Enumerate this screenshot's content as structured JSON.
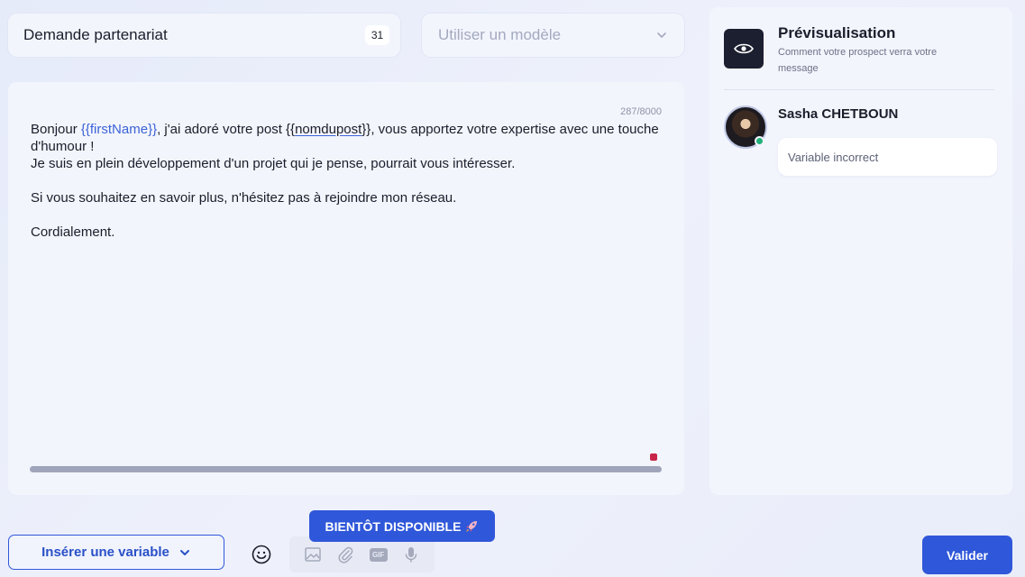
{
  "name_field": {
    "value": "Demande partenariat",
    "count": "31"
  },
  "template_select": {
    "placeholder": "Utiliser un modèle"
  },
  "editor": {
    "counter": "287/8000",
    "line1_a": "Bonjour ",
    "var_firstname": "{{firstName}}",
    "line1_b": ", j'ai adoré votre post ",
    "var_post_open": "{{",
    "var_post_name": "nomdupost",
    "var_post_close": "}}",
    "line1_c": ", vous apportez votre expertise avec une touche d'humour !",
    "line2": "Je suis en plein développement d'un projet qui je pense, pourrait vous intéresser.",
    "line3": "Si vous souhaitez en savoir plus, n'hésitez pas à rejoindre mon réseau.",
    "line4": "Cordialement."
  },
  "preview": {
    "title": "Prévisualisation",
    "subtitle": "Comment votre prospect verra votre message",
    "prospect_name": "Sasha CHETBOUN",
    "bubble_text": "Variable incorrect"
  },
  "toolbar": {
    "insert_variable": "Insérer une variable",
    "coming_soon": "BIENTÔT DISPONIBLE",
    "gif_label": "GIF",
    "submit": "Valider"
  },
  "icons": {
    "eye": "eye-icon",
    "chevron": "chevron-down-icon",
    "emoji": "emoji-icon",
    "image": "image-icon",
    "attach": "paperclip-icon",
    "gif": "gif-icon",
    "mic": "microphone-icon",
    "rocket": "rocket-icon"
  },
  "colors": {
    "accent": "#2f57d9",
    "variable": "#3b63d6",
    "online": "#22b07a",
    "error_marker": "#c72448"
  }
}
